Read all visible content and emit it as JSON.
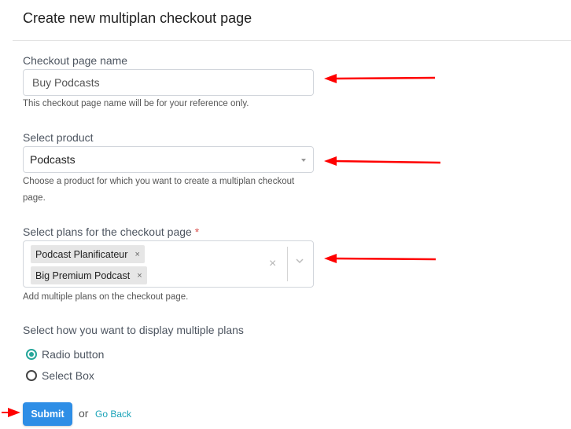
{
  "page": {
    "title": "Create new multiplan checkout page"
  },
  "checkout_name": {
    "label": "Checkout page name",
    "value": "Buy Podcasts",
    "help": "This checkout page name will be for your reference only."
  },
  "product": {
    "label": "Select product",
    "selected": "Podcasts",
    "help": "Choose a product for which you want to create a multiplan checkout page."
  },
  "plans": {
    "label": "Select plans for the checkout page",
    "required_mark": "*",
    "selected": [
      {
        "label": "Podcast Planificateur",
        "remove": "×"
      },
      {
        "label": "Big Premium Podcast",
        "remove": "×"
      }
    ],
    "clear_glyph": "×",
    "help": "Add multiple plans on the checkout page."
  },
  "display": {
    "label": "Select how you want to display multiple plans",
    "options": [
      {
        "label": "Radio button",
        "checked": true
      },
      {
        "label": "Select Box",
        "checked": false
      }
    ]
  },
  "actions": {
    "submit": "Submit",
    "or": "or",
    "go_back": "Go Back"
  },
  "colors": {
    "accent": "#2e8ee6",
    "radio_checked": "#26a69a",
    "link": "#1aa3b8",
    "annotation_arrow": "#ff0000"
  }
}
